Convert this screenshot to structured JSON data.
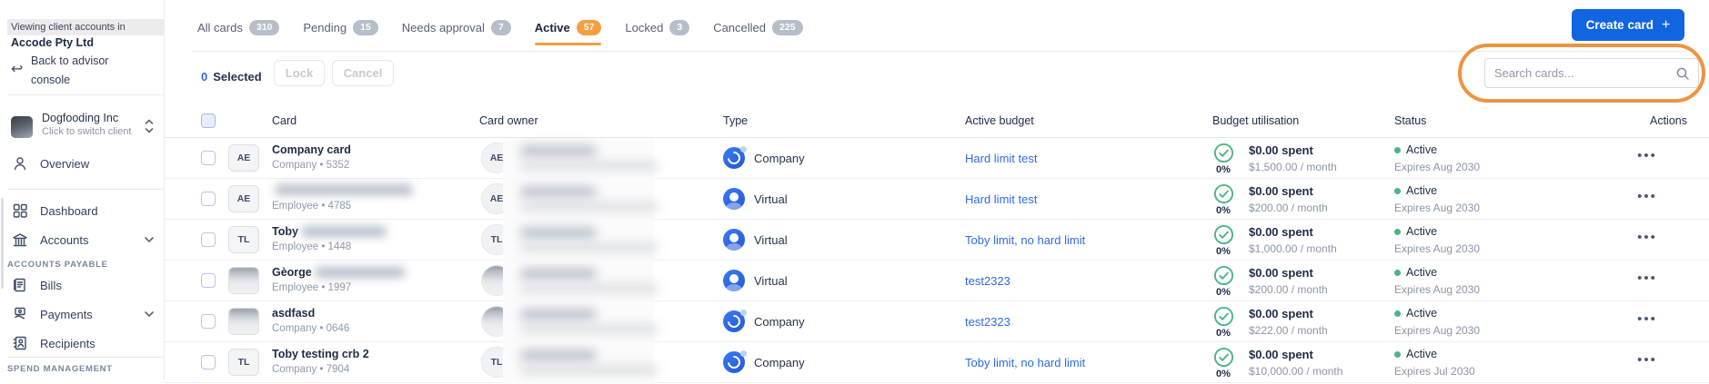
{
  "colors": {
    "accent_blue": "#1165e0",
    "link_blue": "#2d6be4",
    "accent_orange": "#f59e42",
    "annotation_orange": "#ee9440",
    "success_green": "#4db583"
  },
  "sidebar": {
    "banner_line": "Viewing client accounts in",
    "client_account": "Accode Pty Ltd",
    "back_label": "Back to advisor console",
    "switcher": {
      "name": "Dogfooding Inc",
      "hint": "Click to switch client"
    },
    "items": {
      "overview": "Overview",
      "dashboard": "Dashboard",
      "accounts": "Accounts",
      "bills": "Bills",
      "payments": "Payments",
      "recipients": "Recipients"
    },
    "sections": {
      "accounts_payable": "ACCOUNTS PAYABLE",
      "spend_management": "SPEND MANAGEMENT"
    }
  },
  "header": {
    "create_label": "Create card",
    "plus": "+"
  },
  "tabs": [
    {
      "label": "All cards",
      "count": "310",
      "active": false
    },
    {
      "label": "Pending",
      "count": "15",
      "active": false
    },
    {
      "label": "Needs approval",
      "count": "7",
      "active": false
    },
    {
      "label": "Active",
      "count": "57",
      "active": true
    },
    {
      "label": "Locked",
      "count": "3",
      "active": false
    },
    {
      "label": "Cancelled",
      "count": "225",
      "active": false
    }
  ],
  "toolbar": {
    "selected_count": "0",
    "selected_label": "Selected",
    "lock_label": "Lock",
    "cancel_label": "Cancel",
    "search_placeholder": "Search cards...",
    "actions_menu": "•••"
  },
  "table": {
    "headers": [
      "Card",
      "Card owner",
      "Type",
      "Active budget",
      "Budget utilisation",
      "Status",
      "Actions"
    ],
    "rows": [
      {
        "badge": "AE",
        "badge_photo": false,
        "name": "Company card",
        "name_blur_w": 0,
        "subtitle": "Company • 5352",
        "owner": "AE",
        "owner_photo": false,
        "type": "Company",
        "budget": "Hard limit test",
        "pct": "0%",
        "spent": "$0.00 spent",
        "limit": "$1,500.00 / month",
        "status": "Active",
        "expires": "Expires Aug 2030"
      },
      {
        "badge": "AE",
        "badge_photo": false,
        "name": "",
        "name_blur_w": 150,
        "subtitle": "Employee • 4785",
        "owner": "AE",
        "owner_photo": false,
        "type": "Virtual",
        "budget": "Hard limit test",
        "pct": "0%",
        "spent": "$0.00 spent",
        "limit": "$200.00 / month",
        "status": "Active",
        "expires": "Expires Aug 2030"
      },
      {
        "badge": "TL",
        "badge_photo": false,
        "name": "Toby",
        "name_blur_w": 92,
        "subtitle": "Employee • 1448",
        "owner": "TL",
        "owner_photo": false,
        "type": "Virtual",
        "budget": "Toby limit, no hard limit",
        "pct": "0%",
        "spent": "$0.00 spent",
        "limit": "$1,000.00 / month",
        "status": "Active",
        "expires": "Expires Aug 2030"
      },
      {
        "badge": "",
        "badge_photo": true,
        "name": "Gèorge",
        "name_blur_w": 98,
        "subtitle": "Employee • 1997",
        "owner": "",
        "owner_photo": true,
        "type": "Virtual",
        "budget": "test2323",
        "pct": "0%",
        "spent": "$0.00 spent",
        "limit": "$200.00 / month",
        "status": "Active",
        "expires": "Expires Aug 2030"
      },
      {
        "badge": "",
        "badge_photo": true,
        "name": "asdfasd",
        "name_blur_w": 0,
        "subtitle": "Company • 0646",
        "owner": "",
        "owner_photo": true,
        "type": "Company",
        "budget": "test2323",
        "pct": "0%",
        "spent": "$0.00 spent",
        "limit": "$222.00 / month",
        "status": "Active",
        "expires": "Expires Aug 2030"
      },
      {
        "badge": "TL",
        "badge_photo": false,
        "name": "Toby testing crb 2",
        "name_blur_w": 0,
        "subtitle": "Company • 7904",
        "owner": "TL",
        "owner_photo": false,
        "type": "Company",
        "budget": "Toby limit, no hard limit",
        "pct": "0%",
        "spent": "$0.00 spent",
        "limit": "$10,000.00 / month",
        "status": "Active",
        "expires": "Expires Jul 2030"
      }
    ]
  }
}
